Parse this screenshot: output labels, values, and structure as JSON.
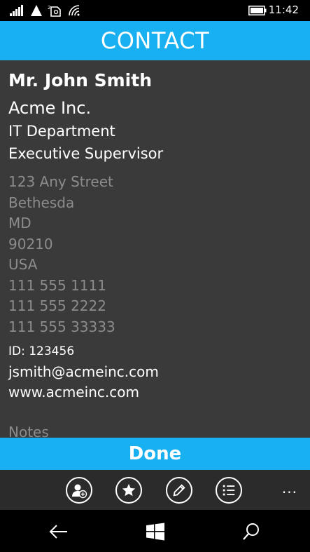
{
  "status_bar": {
    "time": "11:42",
    "icons": [
      "signal-icon",
      "roaming-icon",
      "sim-icon",
      "wifi-icon",
      "battery-icon"
    ]
  },
  "header": {
    "title": "CONTACT"
  },
  "contact": {
    "name": "Mr. John  Smith",
    "company": "Acme Inc.",
    "department": "IT Department",
    "job_title": "Executive Supervisor",
    "street": "123 Any Street",
    "city": "Bethesda",
    "state": "MD",
    "zip": "90210",
    "country": "USA",
    "phones": [
      "111 555 1111",
      "111 555 2222",
      "111 555 33333"
    ],
    "id_line": "ID: 123456",
    "email": "jsmith@acmeinc.com",
    "website": "www.acmeinc.com",
    "notes_label": "Notes"
  },
  "done_button": {
    "label": "Done"
  },
  "app_bar": {
    "buttons": [
      "add-contact-icon",
      "favorite-icon",
      "edit-icon",
      "list-icon"
    ],
    "more_label": "..."
  },
  "nav_bar": {
    "buttons": [
      "back-icon",
      "windows-icon",
      "search-icon"
    ]
  },
  "colors": {
    "accent": "#18b0f0",
    "content_bg": "#3a3a3a",
    "app_bar_bg": "#2b2b2b",
    "muted_text": "#8c8c8c"
  }
}
